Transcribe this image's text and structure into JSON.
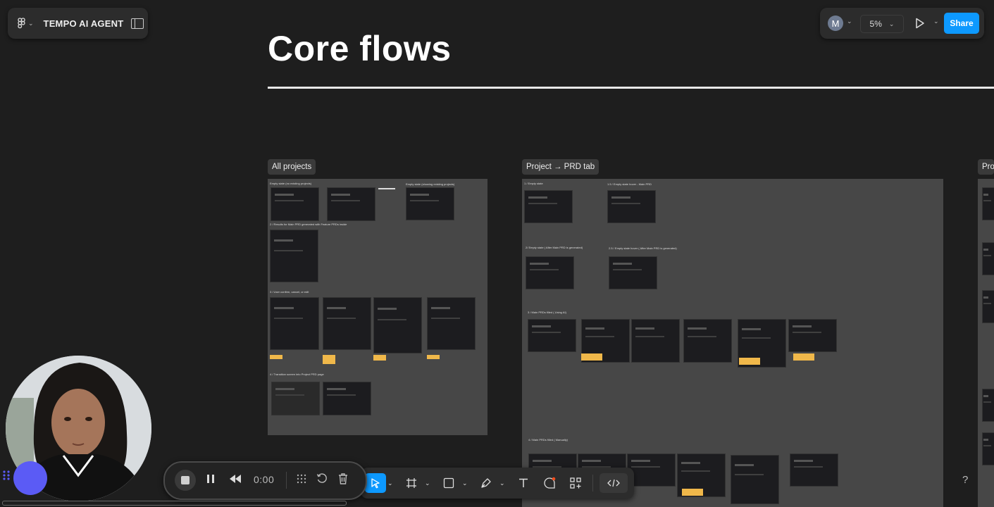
{
  "file": {
    "name": "TEMPO AI AGENT"
  },
  "header": {
    "avatar_initial": "M",
    "zoom": "5%",
    "share_label": "Share"
  },
  "canvas": {
    "title": "Core flows",
    "sections": [
      {
        "label": "All projects",
        "captions": [
          "Empty state (no existing projects)",
          "Empty state (showing existing projects)",
          "2 / Results for Main PRD generated with Feature PRDs inside",
          "3 / User confirm, cancel, or edit",
          "4 / Transition screen into Project PRD page"
        ]
      },
      {
        "label": "Project → PRD tab",
        "captions": [
          "1 / Empty state",
          "1.5 / Empty state hover - Main PRD",
          "2/ Empty state ( After Main PRD is generated)",
          "2.5 / Empty state hover ( After Main PRD is generated)",
          "3 / Main PRDs filled ( Using AI)",
          "4 / Main PRDs filled ( Manually)"
        ]
      },
      {
        "label": "Pro"
      }
    ]
  },
  "recorder": {
    "time": "0:00"
  },
  "toolbar": {
    "tools": [
      "move",
      "frame",
      "rectangle",
      "pen",
      "text",
      "comment",
      "actions",
      "dev-mode"
    ]
  },
  "help": "?"
}
